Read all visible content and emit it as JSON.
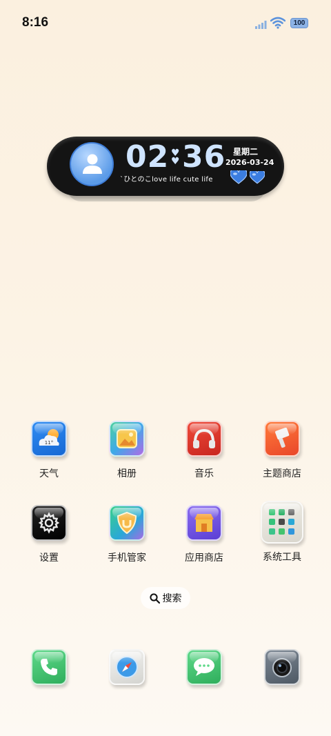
{
  "status_bar": {
    "time": "8:16",
    "battery_level": "100",
    "icons": [
      "signal-icon",
      "wifi-icon",
      "battery-icon"
    ]
  },
  "widget": {
    "hours": "02",
    "minutes": "36",
    "separator_icon": "hearts-icon",
    "tagline": "`ひとのこlove life cute life",
    "weekday": "星期二",
    "date": "2026-03-24",
    "colors": {
      "background": "#141414",
      "clock": "#cfe4ff",
      "accent": "#3e7cd6"
    }
  },
  "apps_row1": [
    {
      "label": "天气",
      "icon": "weather-icon",
      "weather_badge": "11°"
    },
    {
      "label": "相册",
      "icon": "gallery-icon"
    },
    {
      "label": "音乐",
      "icon": "music-headphones-icon"
    },
    {
      "label": "主题商店",
      "icon": "theme-store-brush-icon"
    }
  ],
  "apps_row2": [
    {
      "label": "设置",
      "icon": "settings-gear-icon"
    },
    {
      "label": "手机管家",
      "icon": "security-shield-icon"
    },
    {
      "label": "应用商店",
      "icon": "app-store-shop-icon"
    },
    {
      "label": "系统工具",
      "icon": "system-tools-folder-icon"
    }
  ],
  "search": {
    "label": "搜索",
    "icon": "search-icon"
  },
  "dock": [
    {
      "icon": "phone-icon"
    },
    {
      "icon": "browser-compass-icon"
    },
    {
      "icon": "messages-icon"
    },
    {
      "icon": "camera-icon"
    }
  ]
}
